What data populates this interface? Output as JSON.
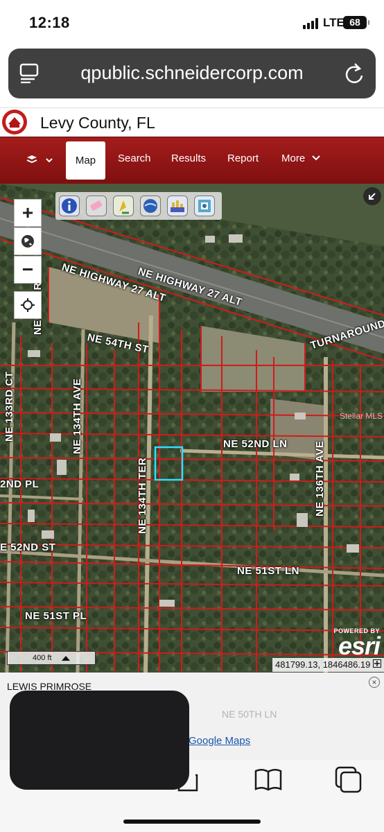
{
  "status_bar": {
    "time": "12:18",
    "network": "LTE",
    "battery": "68"
  },
  "browser": {
    "url": "qpublic.schneidercorp.com",
    "reader_icon": "reader-icon",
    "reload_icon": "reload-icon"
  },
  "site": {
    "title": "Levy County, FL",
    "logo": "county-seal-icon"
  },
  "nav": {
    "items": [
      {
        "label": "Map",
        "active": true
      },
      {
        "label": "Search"
      },
      {
        "label": "Results"
      },
      {
        "label": "Report"
      },
      {
        "label": "More"
      }
    ]
  },
  "map": {
    "controls": {
      "zoom_in": "+",
      "zoom_out": "−"
    },
    "toolbar": [
      "info-icon",
      "eraser-icon",
      "measure-icon",
      "globe-icon",
      "stats-icon",
      "print-icon"
    ],
    "road_labels": {
      "hwy1": "NE HIGHWAY 27 ALT",
      "hwy2": "NE HIGHWAY 27 ALT",
      "turnaround": "TURNAROUND",
      "st54": "NE 54TH ST",
      "ln52": "NE 52ND LN",
      "ave136": "NE 136TH AVE",
      "ave134": "NE 134TH AVE",
      "ter134": "NE 134TH TER",
      "ct133": "NE 133RD CT",
      "pl52": "2ND PL",
      "st52": "E 52ND ST",
      "ln51": "NE 51ST LN",
      "pl51": "NE 51ST PL",
      "ne_left": "NE",
      "ne_top": "NE RC"
    },
    "watermark": "Stellar MLS",
    "attribution": {
      "powered": "POWERED BY",
      "logo": "esri"
    },
    "scale_label": "400 ft",
    "coordinates": "481799.13, 1846486.19",
    "colors": {
      "parcel_line": "#d11b1b",
      "selected_parcel": "#2fe0ff",
      "nav_bg": "#8e1414"
    }
  },
  "info_panel": {
    "owner": "LEWIS PRIMROSE",
    "link": "Google Maps",
    "faded_text": "NE 50TH LN"
  }
}
